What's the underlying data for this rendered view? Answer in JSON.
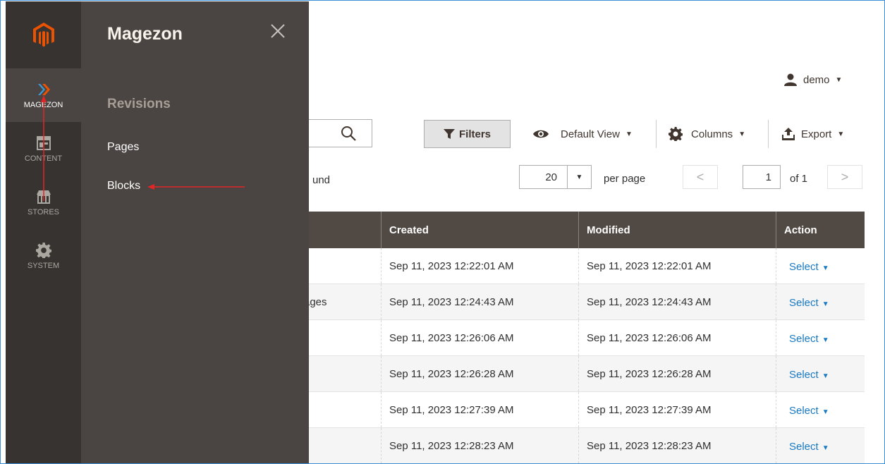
{
  "user": {
    "name": "demo",
    "icon": "user-icon"
  },
  "toolbar": {
    "filters_label": "Filters",
    "view_label": "Default View",
    "columns_label": "Columns",
    "export_label": "Export"
  },
  "records": {
    "found_text": "und"
  },
  "pager": {
    "per_page_value": "20",
    "per_page_label": "per page",
    "current_page": "1",
    "of_label": "of 1"
  },
  "grid": {
    "headers": [
      "",
      "Created",
      "Modified",
      "Action"
    ],
    "rows": [
      {
        "partial": "",
        "created": "Sep 11, 2023 12:22:01 AM",
        "modified": "Sep 11, 2023 12:22:01 AM",
        "action": "Select"
      },
      {
        "partial": "ages",
        "created": "Sep 11, 2023 12:24:43 AM",
        "modified": "Sep 11, 2023 12:24:43 AM",
        "action": "Select"
      },
      {
        "partial": "",
        "created": "Sep 11, 2023 12:26:06 AM",
        "modified": "Sep 11, 2023 12:26:06 AM",
        "action": "Select"
      },
      {
        "partial": "",
        "created": "Sep 11, 2023 12:26:28 AM",
        "modified": "Sep 11, 2023 12:26:28 AM",
        "action": "Select"
      },
      {
        "partial": "",
        "created": "Sep 11, 2023 12:27:39 AM",
        "modified": "Sep 11, 2023 12:27:39 AM",
        "action": "Select"
      },
      {
        "partial": "",
        "created": "Sep 11, 2023 12:28:23 AM",
        "modified": "Sep 11, 2023 12:28:23 AM",
        "action": "Select"
      }
    ]
  },
  "nav": {
    "items": [
      {
        "label": "MAGEZON",
        "icon": "magezon-icon",
        "active": true
      },
      {
        "label": "CONTENT",
        "icon": "content-icon",
        "active": false
      },
      {
        "label": "STORES",
        "icon": "stores-icon",
        "active": false
      },
      {
        "label": "SYSTEM",
        "icon": "gear-icon",
        "active": false
      }
    ]
  },
  "flyout": {
    "title": "Magezon",
    "section": "Revisions",
    "links": [
      "Pages",
      "Blocks"
    ]
  },
  "colors": {
    "nav_bg": "#373330",
    "flyout_bg": "#4a4542",
    "grid_header_bg": "#514943",
    "link": "#1979c3",
    "brand_orange": "#eb5202",
    "annotation_red": "#e22626"
  }
}
